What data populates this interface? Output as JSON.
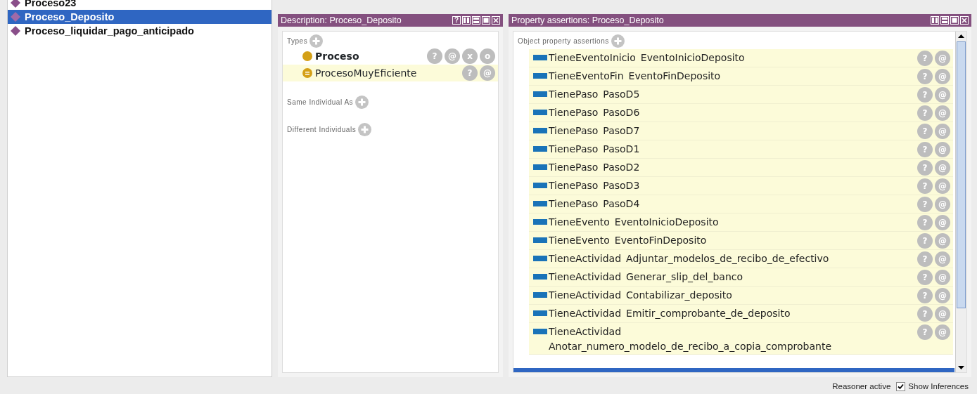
{
  "individuals": [
    {
      "name": "Proceso23",
      "selected": false
    },
    {
      "name": "Proceso_Deposito",
      "selected": true
    },
    {
      "name": "Proceso_liquidar_pago_anticipado",
      "selected": false
    }
  ],
  "description": {
    "title": "Description: Proceso_Deposito",
    "header_help": "?",
    "sections": [
      {
        "label": "Types",
        "items": [
          {
            "name": "Proceso",
            "kind": "asserted",
            "actions": [
              "?",
              "@",
              "x",
              "o"
            ]
          },
          {
            "name": "ProcesoMuyEficiente",
            "kind": "inferred",
            "actions": [
              "?",
              "@"
            ]
          }
        ]
      },
      {
        "label": "Same Individual As"
      },
      {
        "label": "Different Individuals"
      }
    ]
  },
  "properties": {
    "title": "Property assertions: Proceso_Deposito",
    "section": "Object property assertions",
    "rows": [
      {
        "property": "TieneEventoInicio",
        "value": "EventoInicioDeposito",
        "actions": [
          "?",
          "@"
        ]
      },
      {
        "property": "TieneEventoFin",
        "value": "EventoFinDeposito",
        "actions": [
          "?",
          "@"
        ]
      },
      {
        "property": "TienePaso",
        "value": "PasoD5",
        "actions": [
          "?",
          "@"
        ]
      },
      {
        "property": "TienePaso",
        "value": "PasoD6",
        "actions": [
          "?",
          "@"
        ]
      },
      {
        "property": "TienePaso",
        "value": "PasoD7",
        "actions": [
          "?",
          "@"
        ]
      },
      {
        "property": "TienePaso",
        "value": "PasoD1",
        "actions": [
          "?",
          "@"
        ]
      },
      {
        "property": "TienePaso",
        "value": "PasoD2",
        "actions": [
          "?",
          "@"
        ]
      },
      {
        "property": "TienePaso",
        "value": "PasoD3",
        "actions": [
          "?",
          "@"
        ]
      },
      {
        "property": "TienePaso",
        "value": "PasoD4",
        "actions": [
          "?",
          "@"
        ]
      },
      {
        "property": "TieneEvento",
        "value": "EventoInicioDeposito",
        "actions": [
          "?",
          "@"
        ]
      },
      {
        "property": "TieneEvento",
        "value": "EventoFinDeposito",
        "actions": [
          "?",
          "@"
        ]
      },
      {
        "property": "TieneActividad",
        "value": "Adjuntar_modelos_de_recibo_de_efectivo",
        "actions": [
          "?",
          "@"
        ]
      },
      {
        "property": "TieneActividad",
        "value": "Generar_slip_del_banco",
        "actions": [
          "?",
          "@"
        ]
      },
      {
        "property": "TieneActividad",
        "value": "Contabilizar_deposito",
        "actions": [
          "?",
          "@"
        ]
      },
      {
        "property": "TieneActividad",
        "value": "Emitir_comprobante_de_deposito",
        "actions": [
          "?",
          "@"
        ]
      },
      {
        "property": "TieneActividad",
        "value": "Anotar_numero_modelo_de_recibo_a_copia_comprobante",
        "actions": [
          "?",
          "@"
        ]
      }
    ]
  },
  "status_bar": {
    "reasoner": "Reasoner active",
    "show_inferences": {
      "label": "Show Inferences",
      "checked": true
    }
  }
}
